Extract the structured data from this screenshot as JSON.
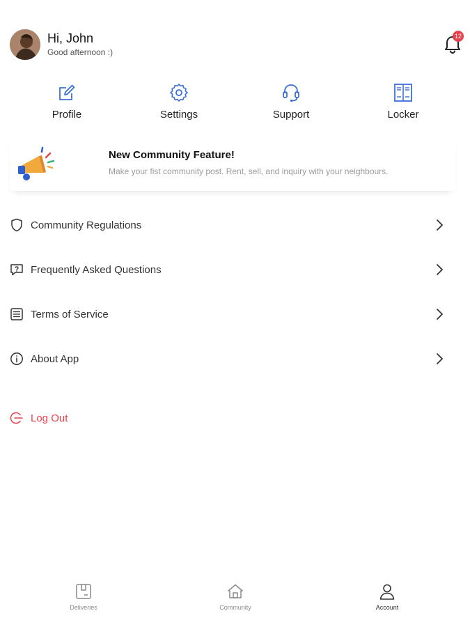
{
  "header": {
    "greeting": "Hi, John",
    "subtitle": "Good afternoon :)",
    "notification_count": "12"
  },
  "quick_actions": [
    {
      "label": "Profile",
      "icon": "edit-icon"
    },
    {
      "label": "Settings",
      "icon": "gear-icon"
    },
    {
      "label": "Support",
      "icon": "headset-icon"
    },
    {
      "label": "Locker",
      "icon": "locker-icon"
    }
  ],
  "banner": {
    "title": "New Community Feature!",
    "text": "Make your fist community post. Rent, sell, and inquiry with your neighbours.",
    "icon": "megaphone-icon"
  },
  "menu": [
    {
      "label": "Community Regulations",
      "icon": "shield-icon"
    },
    {
      "label": "Frequently Asked Questions",
      "icon": "question-bubble-icon"
    },
    {
      "label": "Terms of Service",
      "icon": "document-icon"
    },
    {
      "label": "About App",
      "icon": "info-icon"
    }
  ],
  "logout": {
    "label": "Log Out",
    "icon": "logout-icon"
  },
  "tabbar": [
    {
      "label": "Deliveries",
      "icon": "package-icon",
      "active": false
    },
    {
      "label": "Community",
      "icon": "home-icon",
      "active": false
    },
    {
      "label": "Account",
      "icon": "user-icon",
      "active": true
    }
  ],
  "colors": {
    "accent": "#3b6fd8",
    "danger": "#e5434b",
    "text": "#222222",
    "muted": "#8a8a8a"
  }
}
